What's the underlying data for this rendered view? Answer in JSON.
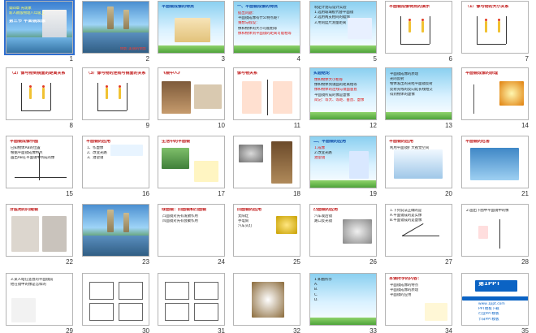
{
  "slides": [
    {
      "number": "1",
      "theme": "title",
      "title": "第三节  平面镜成像",
      "lines": [
        "第四章  光现象",
        "新人教版物理八年级上"
      ]
    },
    {
      "number": "2",
      "theme": "photo",
      "title": "",
      "lines": [
        "倒影  美丽的倒影"
      ]
    },
    {
      "number": "3",
      "theme": "sky",
      "title": "平面镜成像的特点",
      "lines": []
    },
    {
      "number": "4",
      "theme": "sky",
      "title": "一、平面镜成像的特点",
      "lines": [
        "提出问题：",
        "平面镜成像有什么特点呢？",
        "猜想与假设：",
        "像和物体的大小可能相等",
        "像和物体到平面镜的距离可能相等"
      ]
    },
    {
      "number": "5",
      "theme": "sky",
      "title": "",
      "lines": [
        "制定计划与设计实验",
        "1.选用玻璃板代替平面镜",
        "2.选用两支相同的蜡烛",
        "3.用刻度尺测量距离"
      ]
    },
    {
      "number": "6",
      "theme": "white",
      "title": "平面镜成像特点的演示",
      "lines": []
    },
    {
      "number": "7",
      "theme": "white",
      "title": "（1）像与物的大小关系",
      "lines": []
    },
    {
      "number": "8",
      "theme": "white",
      "title": "（2）像与物到镜面的距离关系",
      "lines": []
    },
    {
      "number": "9",
      "theme": "white",
      "title": "（3）像与物的连线与镜面的关系",
      "lines": []
    },
    {
      "number": "10",
      "theme": "white",
      "title": "《镜中人》",
      "lines": []
    },
    {
      "number": "11",
      "theme": "white",
      "title": "像与物关系",
      "lines": []
    },
    {
      "number": "12",
      "theme": "sky",
      "title": "实验结论",
      "lines": [
        "像和物体大小相等",
        "像和物体到镜面的距离相等",
        "像和物体的连线与镜面垂直",
        "平面镜所成的像是虚像",
        "简记：等大、等距、垂直、虚像"
      ]
    },
    {
      "number": "13",
      "theme": "sky",
      "title": "",
      "lines": [
        "平面镜成像的原理",
        "光的反射",
        "物体发出的光经平面镜反射",
        "反射光线的反向延长线相交",
        "得到物体的虚像"
      ]
    },
    {
      "number": "14",
      "theme": "white",
      "title": "平面镜成像的原理",
      "lines": []
    },
    {
      "number": "15",
      "theme": "white",
      "title": "平面镜成像作图",
      "lines": [
        "已知物体AB的位置",
        "根据平面镜成像特点",
        "画出AB在平面镜中所成的像"
      ]
    },
    {
      "number": "16",
      "theme": "white",
      "title": "平面镜的应用",
      "lines": [
        "1、作虚像",
        "2、改变光路",
        "3、潜望镜"
      ]
    },
    {
      "number": "17",
      "theme": "white",
      "title": "生活中的平面镜",
      "lines": []
    },
    {
      "number": "18",
      "theme": "white",
      "title": "",
      "lines": []
    },
    {
      "number": "19",
      "theme": "sky",
      "title": "二、平面镜的应用",
      "lines": [
        "1.成像",
        "2.改变光路",
        "潜望镜"
      ]
    },
    {
      "number": "20",
      "theme": "white",
      "title": "平面镜的应用",
      "lines": [
        "利用平面镜扩大视觉空间"
      ]
    },
    {
      "number": "21",
      "theme": "white",
      "title": "平面镜的危害",
      "lines": []
    },
    {
      "number": "22",
      "theme": "white",
      "title": "牙医用的内窥镜",
      "lines": []
    },
    {
      "number": "23",
      "theme": "photo",
      "title": "",
      "lines": []
    },
    {
      "number": "24",
      "theme": "white",
      "title": "球面镜：凹面镜和凸面镜",
      "lines": [
        "凸面镜对光有发散作用",
        "凹面镜对光有会聚作用"
      ]
    },
    {
      "number": "25",
      "theme": "white",
      "title": "凹面镜的应用",
      "lines": [
        "太阳灶",
        "手电筒",
        "汽车头灯"
      ]
    },
    {
      "number": "26",
      "theme": "white",
      "title": "凸面镜的应用",
      "lines": [
        "汽车观后镜",
        "路口反光镜"
      ]
    },
    {
      "number": "27",
      "theme": "white",
      "title": "",
      "lines": [
        "1.下列说法正确的是",
        "A.平面镜成的是实像",
        "B.平面镜成的是虚像"
      ]
    },
    {
      "number": "28",
      "theme": "white",
      "title": "",
      "lines": [
        "2.画出下图中平面镜中的像"
      ]
    },
    {
      "number": "29",
      "theme": "white",
      "title": "",
      "lines": [
        "3.某人站在竖直的平面镜前",
        "他在镜中的像是怎样的"
      ]
    },
    {
      "number": "30",
      "theme": "white",
      "title": "",
      "lines": []
    },
    {
      "number": "31",
      "theme": "white",
      "title": "",
      "lines": []
    },
    {
      "number": "32",
      "theme": "white",
      "title": "",
      "lines": []
    },
    {
      "number": "33",
      "theme": "sky",
      "title": "",
      "lines": [
        "1.如图所示",
        "A.",
        "B.",
        "C.",
        "D."
      ]
    },
    {
      "number": "34",
      "theme": "white",
      "title": "本课所学的内容：",
      "lines": [
        "平面镜成像的特点",
        "平面镜成像的原理",
        "平面镜的应用"
      ]
    },
    {
      "number": "35",
      "theme": "last",
      "title": "第1PPT",
      "lines": [
        "www.1ppt.com",
        "PPT模板下载",
        "行业PPT模板",
        "节日PPT模板"
      ]
    }
  ]
}
